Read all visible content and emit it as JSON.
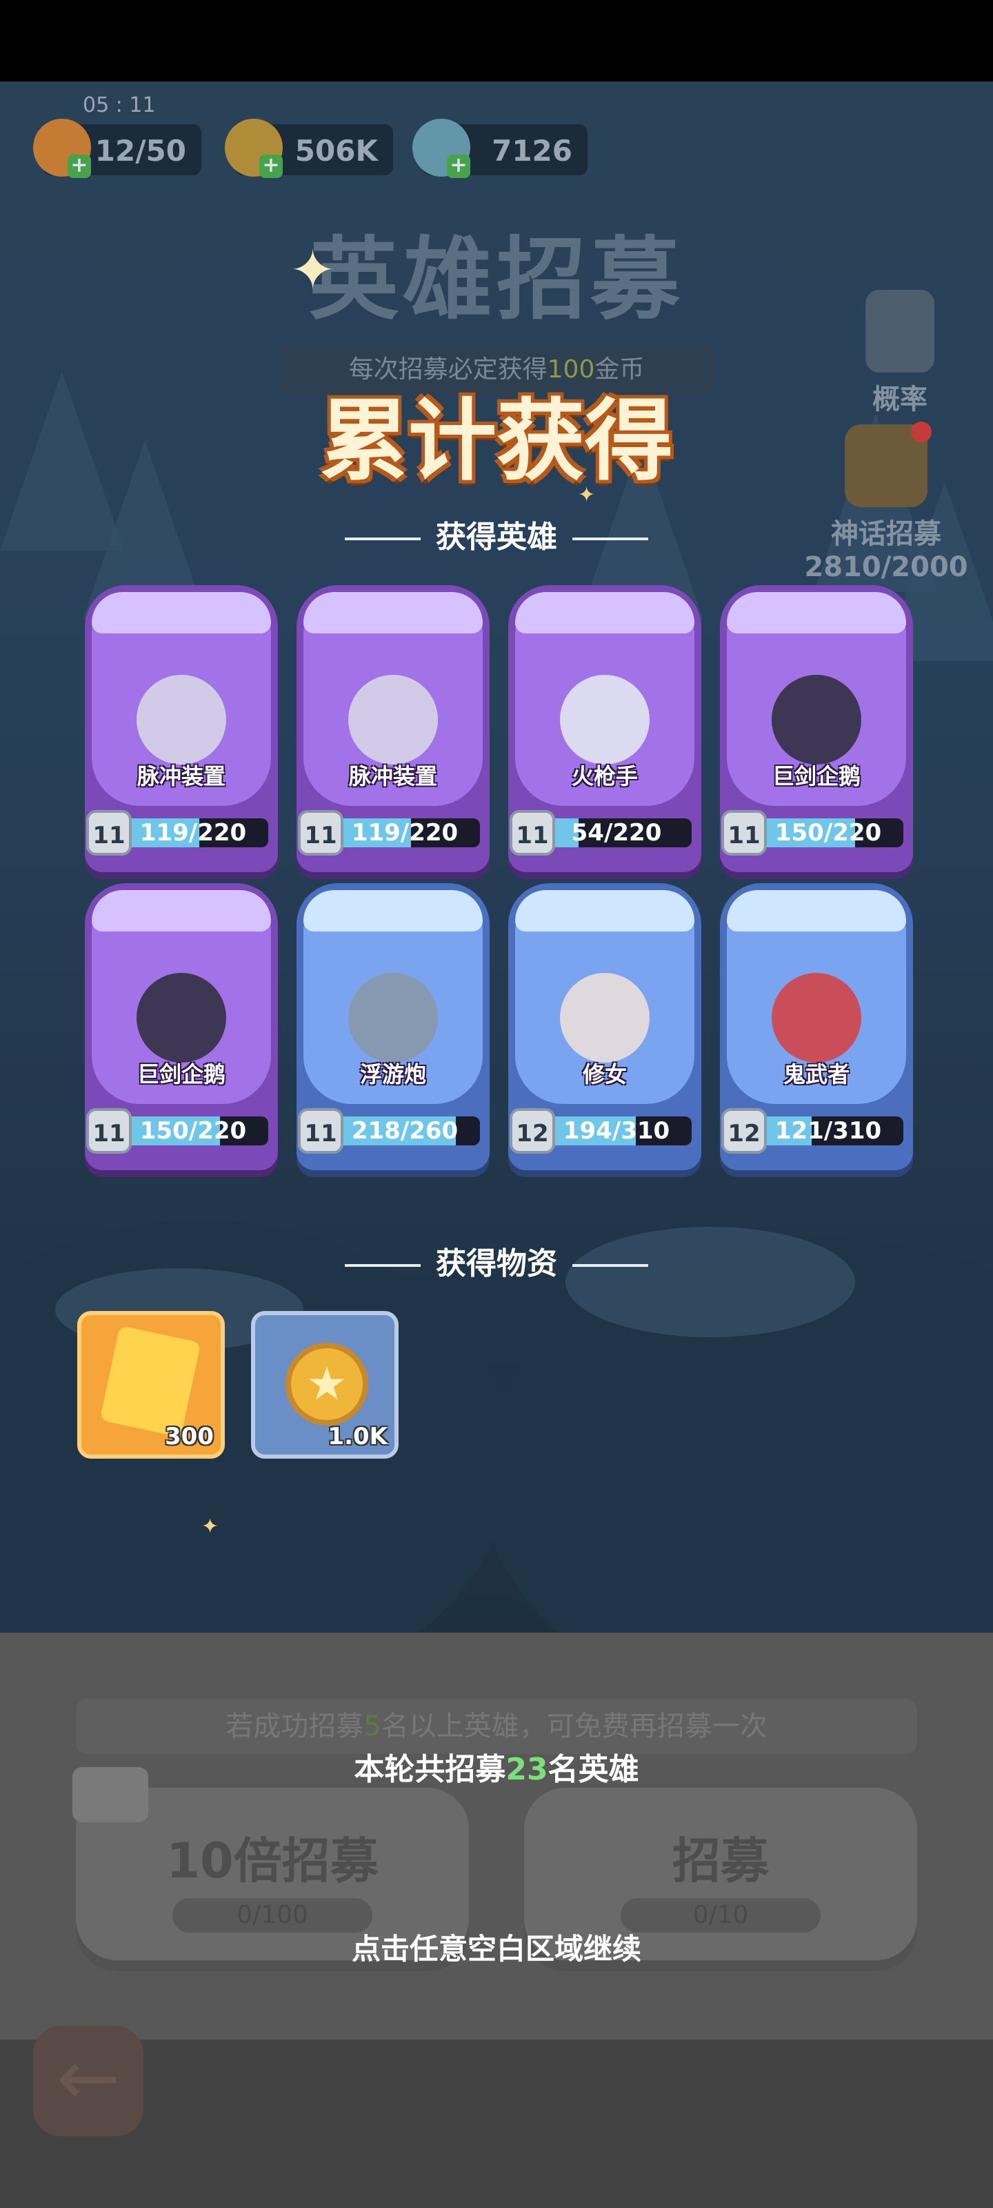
{
  "hud": {
    "time": "05 : 11",
    "stamina": "12/50",
    "gold": "506K",
    "gems": "7126"
  },
  "background": {
    "title": "英雄招募",
    "subtitle_prefix": "每次招募必定获得",
    "subtitle_num": "100",
    "subtitle_suffix": "金币",
    "prob_label": "概率",
    "myth_label": "神话招募",
    "myth_progress": "2810/2000"
  },
  "result": {
    "title": "累计获得",
    "heroes_header": "获得英雄",
    "items_header": "获得物资"
  },
  "heroes": [
    {
      "name": "脉冲装置",
      "level": "11",
      "progress": "119/220",
      "fill": 0.54,
      "rarity": "purple"
    },
    {
      "name": "脉冲装置",
      "level": "11",
      "progress": "119/220",
      "fill": 0.54,
      "rarity": "purple"
    },
    {
      "name": "火枪手",
      "level": "11",
      "progress": "54/220",
      "fill": 0.25,
      "rarity": "purple"
    },
    {
      "name": "巨剑企鹅",
      "level": "11",
      "progress": "150/220",
      "fill": 0.68,
      "rarity": "purple"
    },
    {
      "name": "巨剑企鹅",
      "level": "11",
      "progress": "150/220",
      "fill": 0.68,
      "rarity": "purple"
    },
    {
      "name": "浮游炮",
      "level": "11",
      "progress": "218/260",
      "fill": 0.84,
      "rarity": "blue"
    },
    {
      "name": "修女",
      "level": "12",
      "progress": "194/310",
      "fill": 0.63,
      "rarity": "blue"
    },
    {
      "name": "鬼武者",
      "level": "12",
      "progress": "121/310",
      "fill": 0.39,
      "rarity": "blue"
    }
  ],
  "items": [
    {
      "icon": "crystal-icon",
      "amount": "300"
    },
    {
      "icon": "coin-icon",
      "amount": "1.0K"
    }
  ],
  "bottom": {
    "tip_prefix": "若成功招募",
    "tip_num": "5",
    "tip_suffix": "名以上英雄，可免费再招募一次",
    "recruit_prefix": "本轮共招募",
    "recruit_num": "23",
    "recruit_suffix": "名英雄",
    "btn10_label": "10倍招募",
    "btn10_count": "0/100",
    "btn1_label": "招募",
    "btn1_count": "0/10",
    "continue": "点击任意空白区域继续"
  },
  "colors": {
    "purple_card": "#7b49b8",
    "blue_card": "#4b6fbe",
    "progress_fill": "#6fc6e8",
    "highlight_green": "#7be07a",
    "title_outline": "#b55a1a"
  }
}
